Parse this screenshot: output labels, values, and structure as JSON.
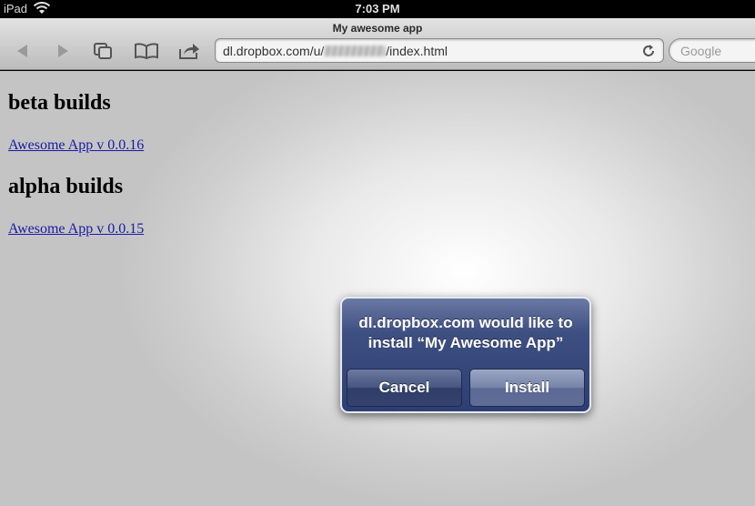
{
  "status_bar": {
    "carrier": "iPad",
    "time": "7:03 PM"
  },
  "browser": {
    "page_title": "My awesome app",
    "url_prefix": "dl.dropbox.com/u/",
    "url_suffix": "/index.html",
    "search_placeholder": "Google"
  },
  "content": {
    "beta_heading": "beta builds",
    "beta_link": "Awesome App v 0.0.16",
    "alpha_heading": "alpha builds",
    "alpha_link": "Awesome App v 0.0.15"
  },
  "alert": {
    "line1": "dl.dropbox.com would like to",
    "line2": "install “My Awesome App”",
    "cancel_label": "Cancel",
    "install_label": "Install"
  },
  "colors": {
    "alert_bg": "#2d3e72",
    "link": "#1a1aa6"
  }
}
